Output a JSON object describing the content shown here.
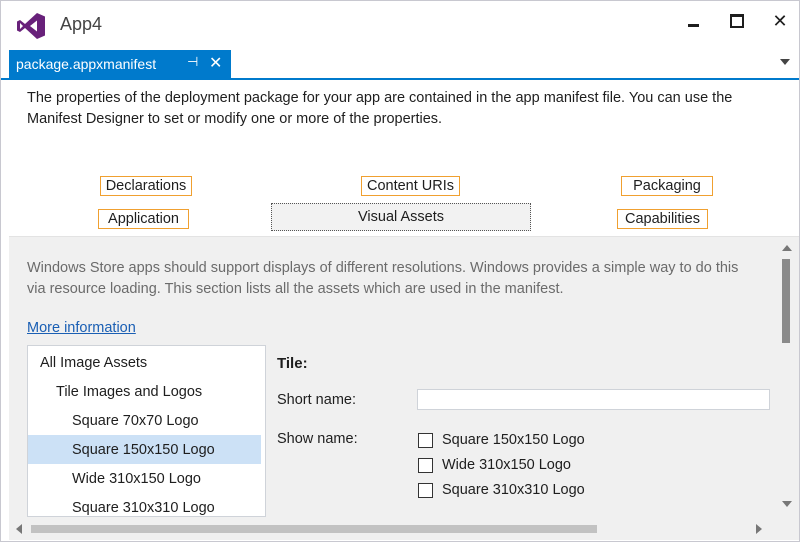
{
  "window": {
    "title": "App4",
    "logo_icon": "visual-studio-logo-icon",
    "accent": "#68217a"
  },
  "document_tab": {
    "label": "package.appxmanifest",
    "pin_icon": "pin-icon",
    "close_icon": "close-icon",
    "color": "#007acc"
  },
  "description": "The properties of the deployment package for your app are contained in the app manifest file. You can use the Manifest Designer to set or modify one or more of the properties.",
  "manifest_tabs": {
    "declarations": "Declarations",
    "content_uris": "Content URIs",
    "packaging": "Packaging",
    "application": "Application",
    "visual_assets": "Visual Assets",
    "capabilities": "Capabilities",
    "active": "Visual Assets",
    "border_color": "#f0a030"
  },
  "visual_assets": {
    "intro": "Windows Store apps should support displays of different resolutions. Windows provides a simple way to do this via resource loading. This section lists all the assets which are used in the manifest.",
    "more_info_link": "More information",
    "tree": [
      "All Image Assets",
      "Tile Images and Logos",
      "Square 70x70 Logo",
      "Square 150x150 Logo",
      "Wide 310x150 Logo",
      "Square 310x310 Logo"
    ],
    "tree_selected": "Square 150x150 Logo",
    "tile": {
      "heading": "Tile:",
      "short_name_label": "Short name:",
      "short_name_value": "",
      "show_name_label": "Show name:",
      "show_name_options": [
        {
          "label": "Square 150x150 Logo",
          "checked": false
        },
        {
          "label": "Wide 310x150 Logo",
          "checked": false
        },
        {
          "label": "Square 310x310 Logo",
          "checked": false
        }
      ]
    }
  }
}
